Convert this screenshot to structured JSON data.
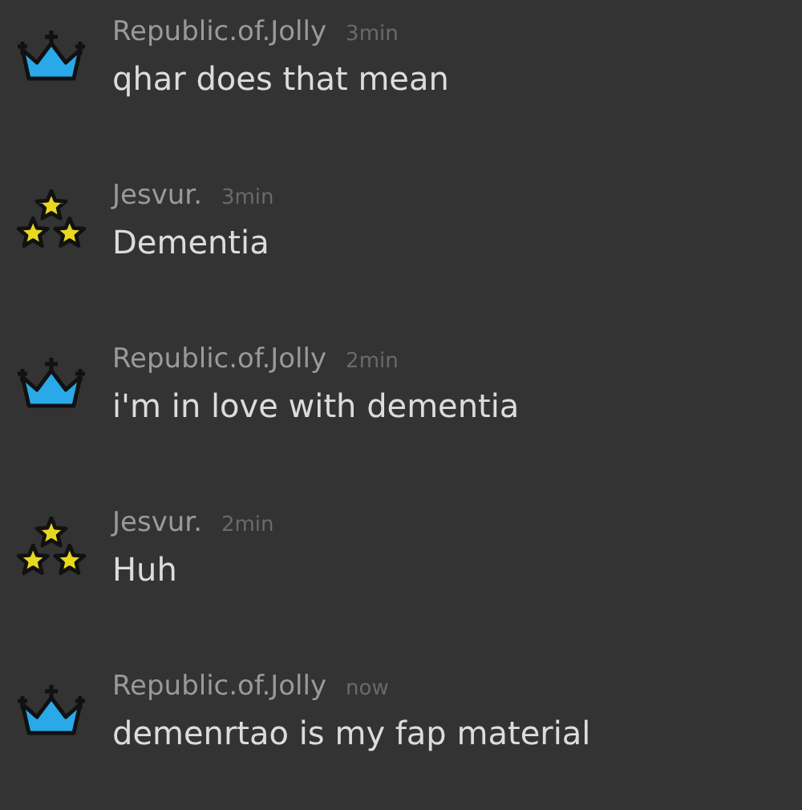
{
  "messages": [
    {
      "kind": "crown",
      "author": "Republic.of.Jolly",
      "time": "3min",
      "text": "qhar does that mean"
    },
    {
      "kind": "stars",
      "author": "Jesvur.",
      "time": "3min",
      "text": "Dementia"
    },
    {
      "kind": "crown",
      "author": "Republic.of.Jolly",
      "time": "2min",
      "text": "i'm in love with dementia"
    },
    {
      "kind": "stars",
      "author": "Jesvur.",
      "time": "2min",
      "text": "Huh"
    },
    {
      "kind": "crown",
      "author": "Republic.of.Jolly",
      "time": "now",
      "text": "demenrtao is my fap material"
    }
  ]
}
